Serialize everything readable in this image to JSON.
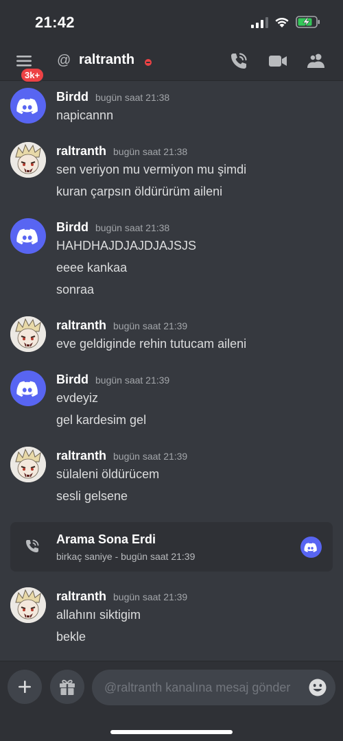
{
  "status_bar": {
    "time": "21:42",
    "icons": [
      "signal-icon",
      "wifi-icon",
      "battery-charging-icon"
    ]
  },
  "header": {
    "badge": "3k+",
    "channel_prefix": "@",
    "channel_name": "raltranth",
    "status": "do-not-disturb",
    "icons": [
      "menu-icon",
      "voice-call-icon",
      "video-call-icon",
      "members-icon"
    ]
  },
  "messages": [
    {
      "author": "Birdd",
      "avatar": "discord-logo",
      "timestamp": "bugün saat 21:38",
      "lines": [
        "napicannn"
      ]
    },
    {
      "author": "raltranth",
      "avatar": "user-avatar",
      "timestamp": "bugün saat 21:38",
      "lines": [
        "sen veriyon mu vermiyon mu şimdi",
        "kuran çarpsın öldürürüm aileni"
      ]
    },
    {
      "author": "Birdd",
      "avatar": "discord-logo",
      "timestamp": "bugün saat 21:38",
      "lines": [
        "HAHDHAJDJAJDJAJSJS",
        "eeee kankaa",
        "sonraa"
      ]
    },
    {
      "author": "raltranth",
      "avatar": "user-avatar",
      "timestamp": "bugün saat 21:39",
      "lines": [
        "eve geldiginde rehin tutucam aileni"
      ]
    },
    {
      "author": "Birdd",
      "avatar": "discord-logo",
      "timestamp": "bugün saat 21:39",
      "lines": [
        "evdeyiz",
        "gel kardesim gel"
      ]
    },
    {
      "author": "raltranth",
      "avatar": "user-avatar",
      "timestamp": "bugün saat 21:39",
      "lines": [
        "sülaleni öldürücem",
        "sesli gelsene"
      ]
    }
  ],
  "call": {
    "title": "Arama Sona Erdi",
    "subtitle": "birkaç saniye - bugün saat 21:39"
  },
  "last_message": {
    "author": "raltranth",
    "timestamp": "bugün saat 21:39",
    "lines": [
      "allahını siktigim",
      "bekle"
    ]
  },
  "composer": {
    "placeholder": "@raltranth kanalına mesaj gönder",
    "value": ""
  },
  "colors": {
    "background": "#36393f",
    "header": "#2f3136",
    "blurple": "#5865f2",
    "red": "#ed4245",
    "input": "#40444b"
  }
}
